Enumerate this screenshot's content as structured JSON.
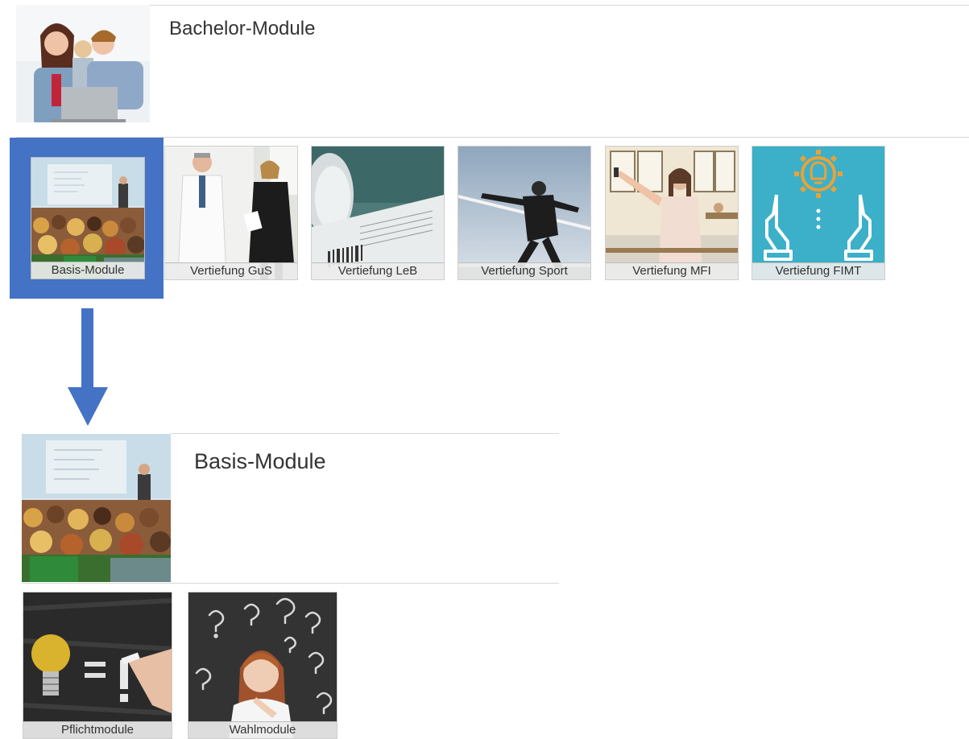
{
  "bachelor": {
    "title": "Bachelor-Module",
    "tiles": [
      {
        "label": "Basis-Module"
      },
      {
        "label": "Vertiefung GuS"
      },
      {
        "label": "Vertiefung LeB"
      },
      {
        "label": "Vertiefung Sport"
      },
      {
        "label": "Vertiefung MFI"
      },
      {
        "label": "Vertiefung FIMT"
      }
    ]
  },
  "basis": {
    "title": "Basis-Module",
    "tiles": [
      {
        "label": "Pflichtmodule"
      },
      {
        "label": "Wahlmodule"
      }
    ]
  },
  "colors": {
    "highlight": "#4472c4",
    "fimt_bg": "#3cb0c8",
    "fimt_icon": "#e8a23a"
  }
}
